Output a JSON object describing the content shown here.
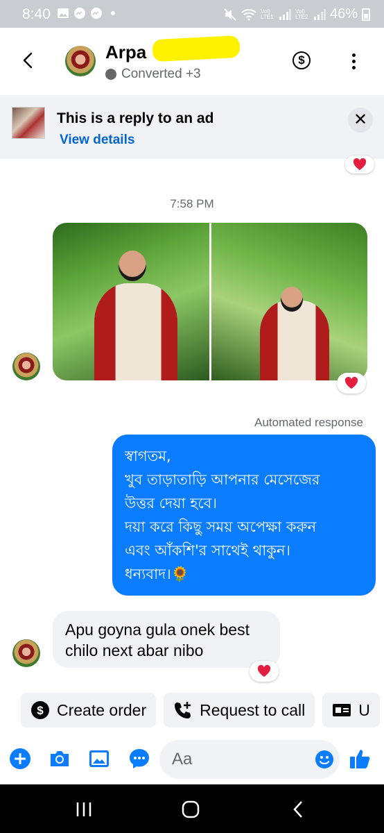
{
  "status_bar": {
    "time": "8:40",
    "battery": "46%",
    "sim1": "Vol) LTE1",
    "sim2": "Vol) LTE2"
  },
  "header": {
    "contact_name": "Arpa",
    "presence": "Converted +3"
  },
  "ad_banner": {
    "title": "This is a reply to an ad",
    "link": "View details"
  },
  "messages": {
    "timestamp": "7:58 PM",
    "automated_label": "Automated response",
    "auto_reply_lines": [
      "স্বাগতম,",
      "খুব তাড়াতাড়ি আপনার মেসেজের",
      "উত্তর দেয়া হবে।",
      "দয়া করে কিছু সময় অপেক্ষা করুন",
      "এবং আঁকশি'র সাথেই থাকুন।",
      "ধন্যবাদ।🌻"
    ],
    "incoming_text": "Apu goyna gula onek best chilo next abar nibo"
  },
  "quick_actions": {
    "create_order": "Create order",
    "request_call": "Request to call",
    "third_partial": "U"
  },
  "composer": {
    "placeholder": "Aa"
  },
  "colors": {
    "messenger_blue": "#0a7cff",
    "link_blue": "#0064d1",
    "heart_red": "#e41e3f",
    "bubble_gray": "#f0f2f5",
    "status_bar_gray": "#c9ccd1"
  }
}
